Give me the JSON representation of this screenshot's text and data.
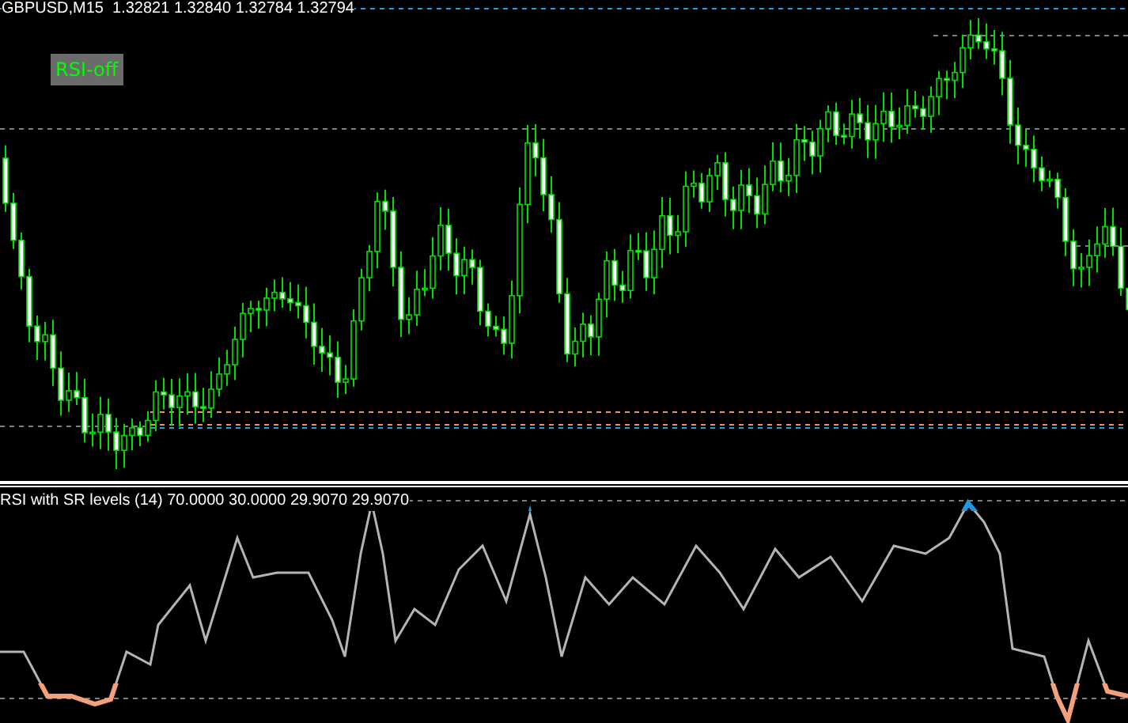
{
  "chart": {
    "title": "GBPUSD,M15  1.32821 1.32840 1.32784 1.32794"
  },
  "rsi_button": {
    "label": "RSI-off",
    "on": false
  },
  "indicator": {
    "label": "RSI with SR levels (14) 70.0000 30.0000 29.9070 29.9070"
  }
}
